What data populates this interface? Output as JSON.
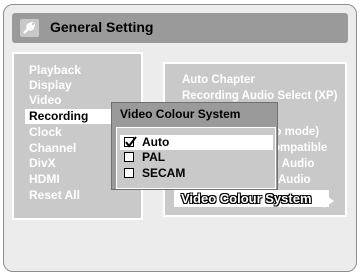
{
  "header": {
    "title": "General Setting",
    "icon": "wrench-icon"
  },
  "left_menu": {
    "items": [
      {
        "label": "Playback"
      },
      {
        "label": "Display"
      },
      {
        "label": "Video"
      },
      {
        "label": "Recording",
        "selected": true
      },
      {
        "label": "Clock"
      },
      {
        "label": "Channel"
      },
      {
        "label": "DivX"
      },
      {
        "label": "HDMI"
      },
      {
        "label": "Reset All"
      }
    ]
  },
  "recording_submenu": {
    "items": [
      {
        "label": "Auto Chapter"
      },
      {
        "label": "Recording Audio Select (XP)"
      },
      {
        "label": "eo mode)"
      },
      {
        "label": "ompatible"
      },
      {
        "label": "g Audio"
      },
      {
        "label": "Audio"
      },
      {
        "label": "Video Colour System",
        "highlighted": true
      }
    ]
  },
  "popup": {
    "title": "Video Colour System",
    "options": [
      {
        "label": "Auto",
        "checked": true
      },
      {
        "label": "PAL",
        "checked": false
      },
      {
        "label": "SECAM",
        "checked": false
      }
    ]
  },
  "colors": {
    "panel": "#c9c9c9",
    "header": "#9a9a9a",
    "background": "#ececec"
  }
}
